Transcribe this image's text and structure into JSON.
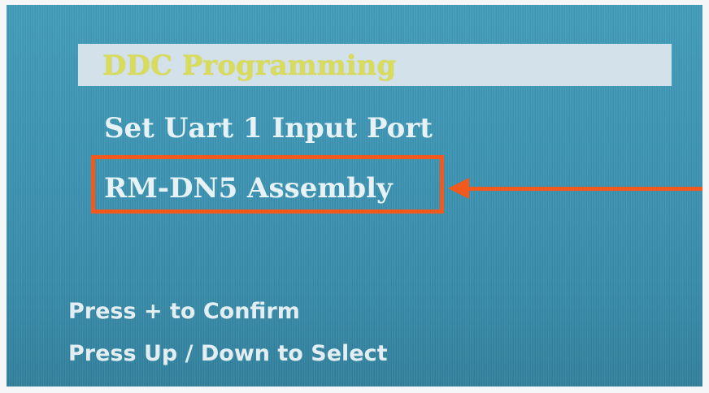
{
  "menu": {
    "items": [
      {
        "label": "DDC Programming",
        "selected": true
      },
      {
        "label": "Set Uart 1 Input Port",
        "selected": false
      },
      {
        "label": "RM-DN5 Assembly",
        "selected": false
      }
    ]
  },
  "annotation": {
    "color": "#f15a1c",
    "target": "RM-DN5 Assembly"
  },
  "hints": {
    "confirm": "Press + to Confirm",
    "select": "Press Up / Down to Select"
  },
  "colors": {
    "screen_bg": "#3a93b2",
    "selected_bg": "#d3e1ea",
    "selected_text": "#d8dc5a",
    "text": "#e7f2f6"
  }
}
